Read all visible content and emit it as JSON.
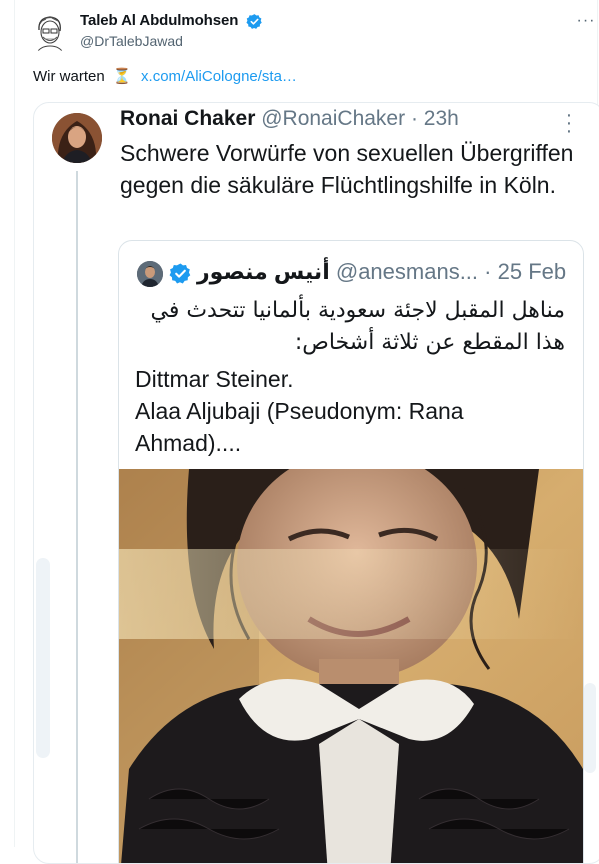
{
  "author": {
    "name": "Taleb Al Abdulmohsen",
    "handle": "@DrTalebJawad"
  },
  "tweet": {
    "text": "Wir warten",
    "emoji": "⏳",
    "link": "x.com/AliCologne/sta…"
  },
  "quoted": {
    "name": "Ronai Chaker",
    "handle": "@RonaiChaker",
    "separator": "·",
    "time": "23h",
    "text": "Schwere Vorwürfe von sexuellen Übergriffen gegen die säkuläre Flüchtlingshilfe in Köln.",
    "inner": {
      "name": "أنيس منصور",
      "handle": "@anesmans...",
      "separator": "·",
      "date": "25 Feb",
      "arabic_text": "مناهل المقبل لاجئة سعودية بألمانيا تتحدث في هذا المقطع عن ثلاثة أشخاص:",
      "latin_line1": "Dittmar Steiner.",
      "latin_line2": "Alaa Aljubaji (Pseudonym: Rana Ahmad)...."
    }
  },
  "colors": {
    "link": "#1d9bf0",
    "verified": "#1d9bf0",
    "secondary_text": "#536471"
  }
}
